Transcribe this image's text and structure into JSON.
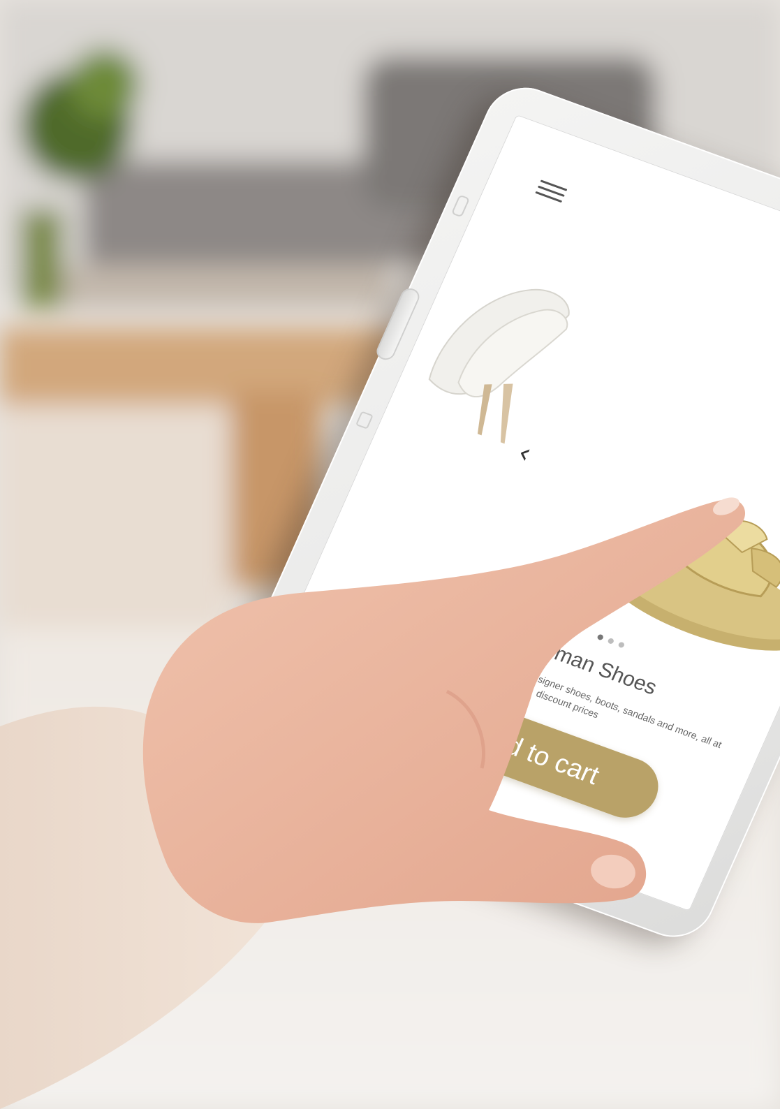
{
  "app": {
    "menu_icon": "hamburger-menu-icon",
    "prev_icon": "chevron-left-icon",
    "prev_glyph": "‹"
  },
  "product": {
    "title": "Woman Shoes",
    "description": "Shop online for women's designer shoes, boots, sandals and more, all at discount prices",
    "carousel": {
      "count": 3,
      "active_index": 0
    },
    "cta_label": "Add to cart"
  },
  "colors": {
    "accent": "#b9a268",
    "screen": "#ffffff",
    "tablet_frame": "#eeeeed"
  }
}
